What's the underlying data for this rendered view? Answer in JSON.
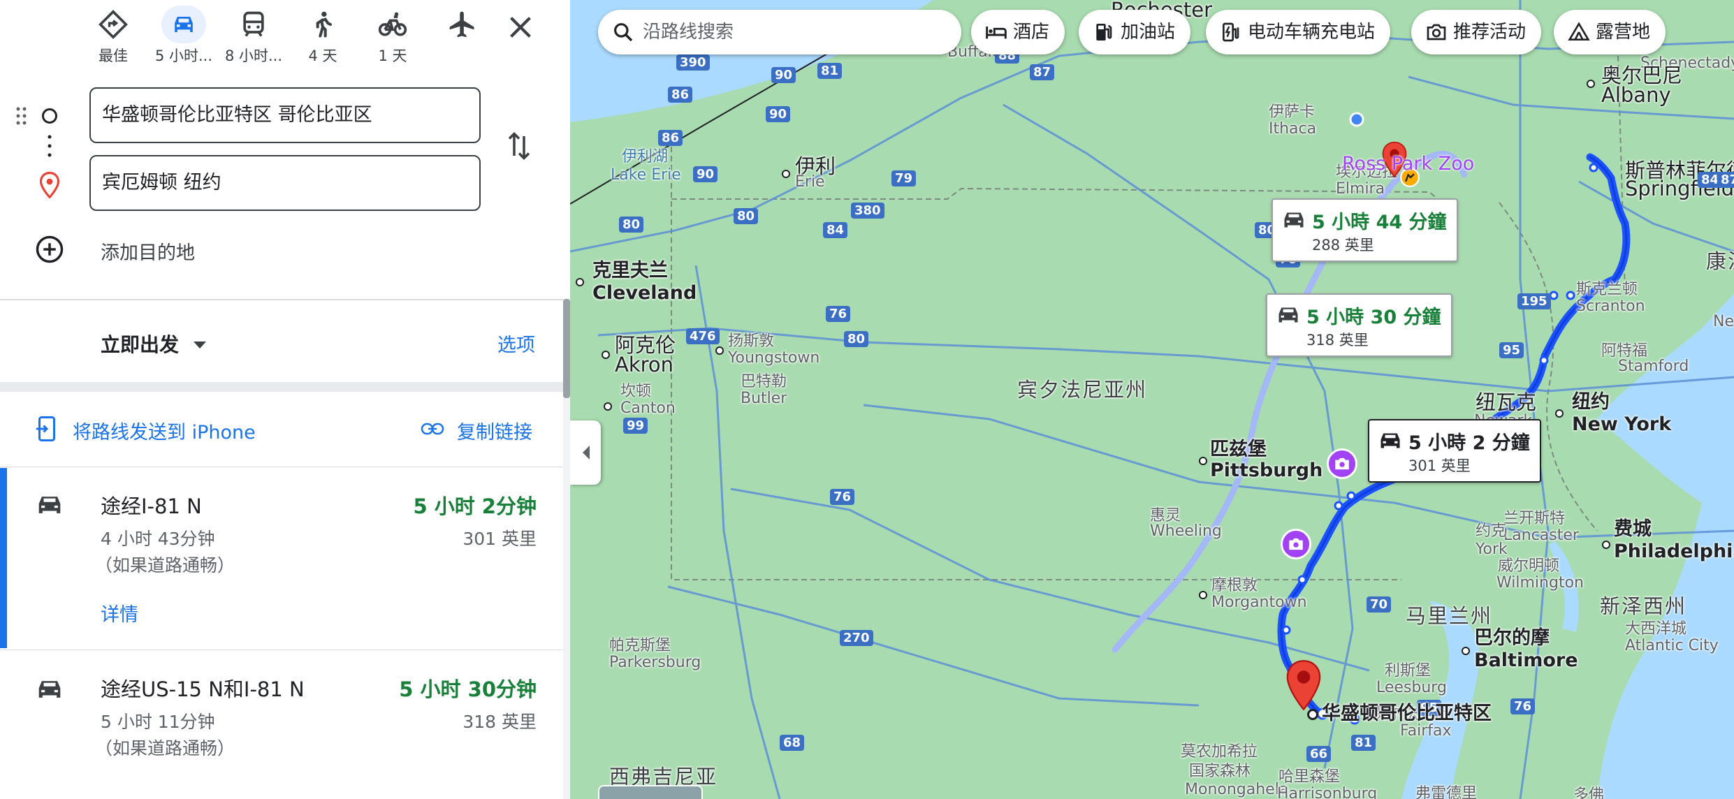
{
  "colors": {
    "accent": "#1a73e8",
    "route_green": "#188038",
    "route_blue": "#1a53ff",
    "poi_purple": "#a142f4",
    "pin_red": "#ea4335",
    "map_green": "#a8dbaf",
    "water": "#aadaff"
  },
  "travel_modes": [
    {
      "label": "最佳",
      "icon": "best-route-icon"
    },
    {
      "label": "5 小时...",
      "icon": "car-icon"
    },
    {
      "label": "8 小时...",
      "icon": "transit-icon"
    },
    {
      "label": "4 天",
      "icon": "walk-icon"
    },
    {
      "label": "1 天",
      "icon": "bicycle-icon"
    },
    {
      "label": "",
      "icon": "flight-icon"
    }
  ],
  "directions": {
    "origin": "华盛顿哥伦比亚特区 哥伦比亚区",
    "destination": "宾厄姆顿 纽约",
    "add_destination": "添加目的地"
  },
  "departure": {
    "label": "立即出发",
    "options_label": "选项"
  },
  "share": {
    "send_to_phone": "将路线发送到 iPhone",
    "copy_link": "复制链接"
  },
  "routes": [
    {
      "title": "途经I-81 N",
      "duration": "5 小时 2分钟",
      "typical": "4 小时 43分钟",
      "distance": "301 英里",
      "note": "（如果道路通畅）",
      "details_label": "详情"
    },
    {
      "title": "途经US-15 N和I-81 N",
      "duration": "5 小时 30分钟",
      "typical": "5 小时 11分钟",
      "distance": "318 英里",
      "note": "（如果道路通畅）"
    }
  ],
  "map": {
    "search_placeholder": "沿路线搜索",
    "chips": [
      {
        "label": "酒店",
        "icon": "hotel-icon"
      },
      {
        "label": "加油站",
        "icon": "gas-station-icon"
      },
      {
        "label": "电动车辆充电站",
        "icon": "ev-charger-icon"
      },
      {
        "label": "推荐活动",
        "icon": "camera-icon"
      },
      {
        "label": "露营地",
        "icon": "campground-icon"
      }
    ],
    "callouts": [
      {
        "time": "5 小時 44 分鐘",
        "distance": "288 英里"
      },
      {
        "time": "5 小時 30 分鐘",
        "distance": "318 英里"
      },
      {
        "time": "5 小時 2 分鐘",
        "distance": "301 英里"
      }
    ],
    "poi": {
      "zoo": "Ross Park Zoo"
    },
    "destination_label": "华盛顿哥伦比亚特区",
    "places": {
      "rochester": "Rochester",
      "buffalo": "Buffalo",
      "lake_erie_zh": "伊利湖",
      "lake_erie_en": "Lake Erie",
      "erie_zh": "伊利",
      "erie_en": "Erie",
      "ithaca_zh": "伊萨卡",
      "ithaca_en": "Ithaca",
      "elmira_zh": "埃尔迈拉",
      "elmira_en": "Elmira",
      "schenectady": "Schenectady",
      "albany_zh": "奥尔巴尼",
      "albany_en": "Albany",
      "springfield_zh": "斯普林菲尔德",
      "springfield_en": "Springfield",
      "connecticut_zh": "康涅",
      "newyork_edge": "Ne",
      "cleveland_zh": "克里夫兰",
      "cleveland_en": "Cleveland",
      "scranton_zh": "斯克兰顿",
      "scranton_en": "Scranton",
      "akron_zh": "阿克伦",
      "akron_en": "Akron",
      "youngstown_zh": "扬斯敦",
      "youngstown_en": "Youngstown",
      "allentown_zh": "阿特福",
      "stamford_en": "Stamford",
      "butler_zh": "巴特勒",
      "butler_en": "Butler",
      "pa_state": "宾夕法尼亚州",
      "newark_zh": "纽瓦克",
      "newark_en": "Newark",
      "nyc_zh": "纽约",
      "nyc_en": "New York",
      "canton_zh": "坎顿",
      "canton_en": "Canton",
      "pittsburgh_zh": "匹兹堡",
      "pittsburgh_en": "Pittsburgh",
      "wheeling_zh": "惠灵",
      "wheeling_en": "Wheeling",
      "lancaster_zh": "兰开斯特",
      "lancaster_en": "Lancaster",
      "york_zh": "约克",
      "york_en": "York",
      "philly_zh": "费城",
      "philly_en": "Philadelphia",
      "wilmington_zh": "威尔明顿",
      "wilmington_en": "Wilmington",
      "morgantown_zh": "摩根敦",
      "morgantown_en": "Morgantown",
      "md_state": "马里兰州",
      "nj_state": "新泽西州",
      "baltimore_zh": "巴尔的摩",
      "baltimore_en": "Baltimore",
      "atlantic_zh": "大西洋城",
      "atlantic_en": "Atlantic City",
      "parkersburg_zh": "帕克斯堡",
      "parkersburg_en": "Parkersburg",
      "leesburg_zh": "利斯堡",
      "leesburg_en": "Leesburg",
      "fairfax_zh": "费尔法克斯",
      "fairfax_en": "Fairfax",
      "wv_state": "西弗吉尼亚",
      "monongahela_zh1": "莫农加希拉",
      "monongahela_zh2": "国家森林",
      "monongahela_en": "Monongahela",
      "harrisonburg_zh": "哈里森堡",
      "harrisonburg_en": "Harrisonburg",
      "fredericksburg_zh": "弗雷德里",
      "dover_zh": "多佛"
    },
    "highways": [
      "90",
      "390",
      "81",
      "88",
      "87",
      "86",
      "90",
      "86",
      "90",
      "79",
      "84",
      "80",
      "80",
      "380",
      "80",
      "84",
      "87",
      "80",
      "76",
      "99",
      "76",
      "476",
      "195",
      "76",
      "95",
      "76",
      "68",
      "70",
      "270",
      "95",
      "81",
      "66"
    ]
  }
}
